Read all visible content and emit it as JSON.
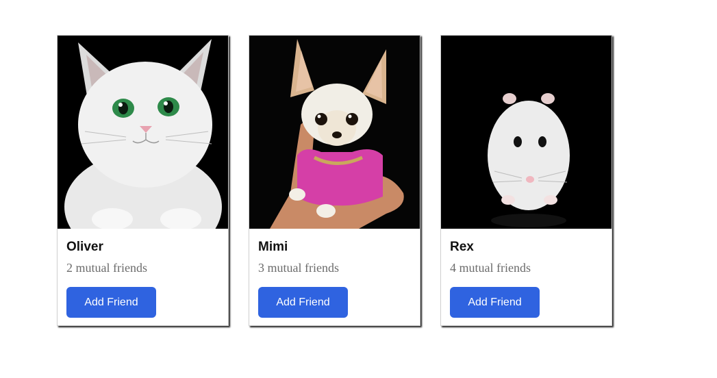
{
  "cards": [
    {
      "name": "Oliver",
      "mutual": "2 mutual friends",
      "button_label": "Add Friend",
      "photo": "white-kitten-photo"
    },
    {
      "name": "Mimi",
      "mutual": "3 mutual friends",
      "button_label": "Add Friend",
      "photo": "chihuahua-in-pink-sweater-photo"
    },
    {
      "name": "Rex",
      "mutual": "4 mutual friends",
      "button_label": "Add Friend",
      "photo": "white-hamster-photo"
    }
  ],
  "colors": {
    "button_bg": "#2f63e0",
    "button_text": "#ffffff",
    "mutual_text": "#6b6b6b"
  }
}
